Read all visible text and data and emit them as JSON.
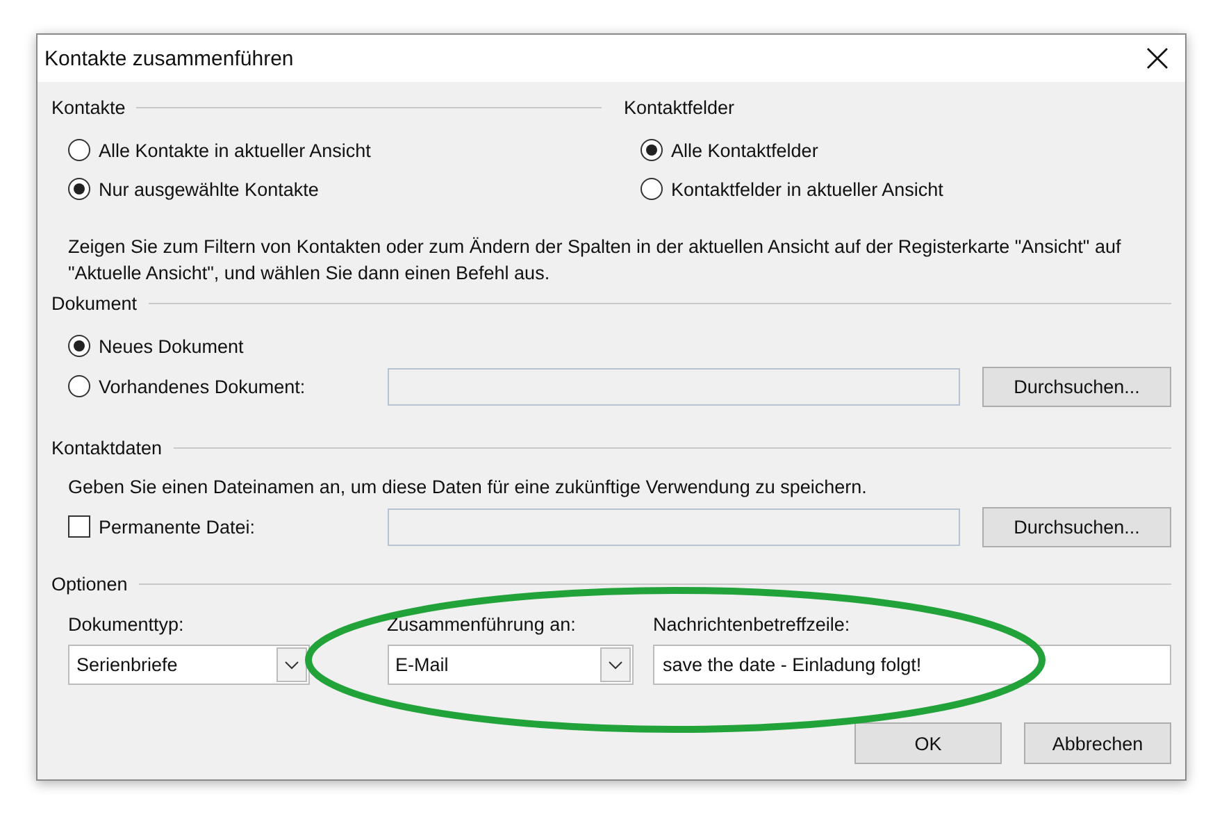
{
  "window": {
    "title": "Kontakte zusammenführen"
  },
  "contacts": {
    "label": "Kontakte",
    "options": [
      {
        "label": "Alle Kontakte in aktueller Ansicht",
        "selected": false
      },
      {
        "label": "Nur ausgewählte Kontakte",
        "selected": true
      }
    ]
  },
  "contact_fields": {
    "label": "Kontaktfelder",
    "options": [
      {
        "label": "Alle Kontaktfelder",
        "selected": true
      },
      {
        "label": "Kontaktfelder in aktueller Ansicht",
        "selected": false
      }
    ]
  },
  "hint": "Zeigen Sie zum Filtern von Kontakten oder zum Ändern der Spalten in der aktuellen Ansicht auf der Registerkarte \"Ansicht\" auf \"Aktuelle Ansicht\", und wählen Sie dann einen Befehl aus.",
  "document": {
    "label": "Dokument",
    "options": [
      {
        "label": "Neues Dokument",
        "selected": true
      },
      {
        "label": "Vorhandenes Dokument:",
        "selected": false
      }
    ],
    "browse_button": "Durchsuchen..."
  },
  "contact_data": {
    "label": "Kontaktdaten",
    "hint": "Geben Sie einen Dateinamen an, um diese Daten für eine zukünftige Verwendung zu speichern.",
    "permanent_file": {
      "label": "Permanente Datei:",
      "checked": false
    },
    "browse_button": "Durchsuchen..."
  },
  "options": {
    "label": "Optionen",
    "document_type": {
      "label": "Dokumenttyp:",
      "value": "Serienbriefe"
    },
    "merge_to": {
      "label": "Zusammenführung an:",
      "value": "E-Mail"
    },
    "subject": {
      "label": "Nachrichtenbetreffzeile:",
      "value": "save the date - Einladung folgt!"
    }
  },
  "buttons": [
    "OK",
    "Abbrechen"
  ]
}
